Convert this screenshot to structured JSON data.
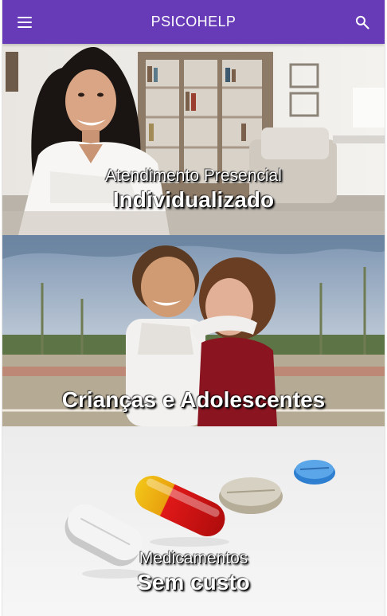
{
  "app": {
    "title": "PSICOHELP",
    "menu_icon": "menu-icon",
    "search_icon": "search-icon",
    "accent_color": "#673ab7"
  },
  "cards": [
    {
      "subtitle": "Atendimento Presencial",
      "title": "Individualizado"
    },
    {
      "subtitle": "",
      "title": "Crianças e Adolescentes"
    },
    {
      "subtitle": "Medicamentos",
      "title": "Sem custo"
    }
  ]
}
